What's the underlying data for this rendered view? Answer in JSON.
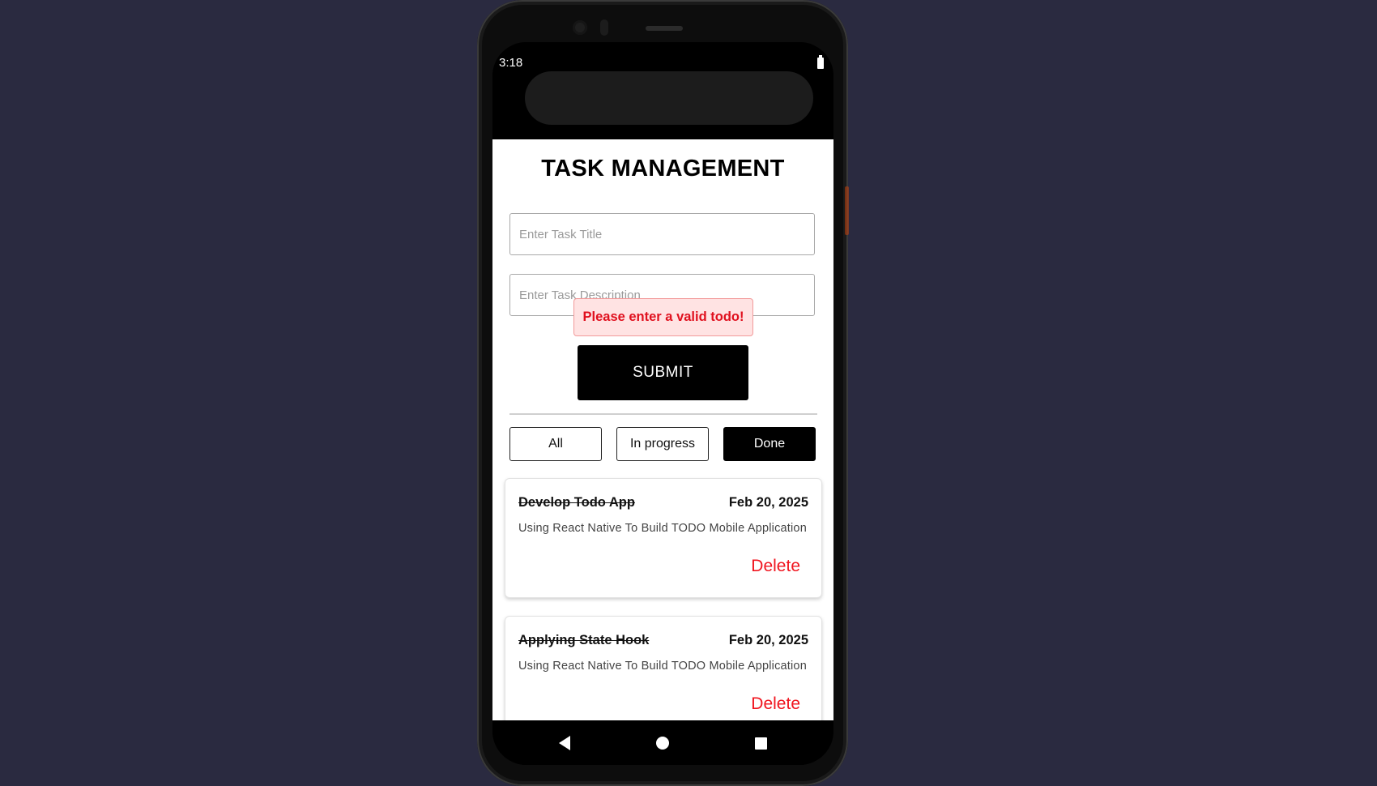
{
  "status_bar": {
    "time": "3:18"
  },
  "app": {
    "title": "TASK MANAGEMENT",
    "form": {
      "title_placeholder": "Enter Task Title",
      "description_placeholder": "Enter Task Description",
      "error_message": "Please enter a valid todo!",
      "submit_label": "SUBMIT"
    },
    "filters": [
      {
        "label": "All",
        "active": false
      },
      {
        "label": "In progress",
        "active": false
      },
      {
        "label": "Done",
        "active": true
      }
    ],
    "tasks": [
      {
        "title": "Develop Todo App",
        "date": "Feb 20, 2025",
        "description": "Using React Native To Build TODO Mobile Application",
        "delete_label": "Delete",
        "completed": true
      },
      {
        "title": "Applying State Hook",
        "date": "Feb 20, 2025",
        "description": "Using React Native To Build TODO Mobile Application",
        "delete_label": "Delete",
        "completed": true
      }
    ]
  },
  "nav_bar": {
    "icons": [
      "back-icon",
      "home-icon",
      "recents-icon"
    ]
  },
  "colors": {
    "background": "#2a2a40",
    "error_text": "#e0101e",
    "error_bg": "#ffe3e3",
    "delete": "#f0141e",
    "primary": "#000000"
  }
}
